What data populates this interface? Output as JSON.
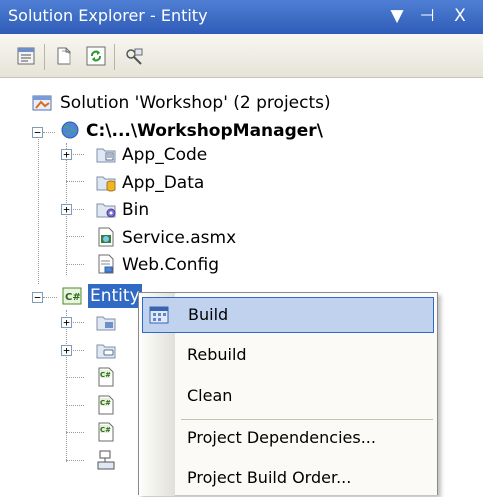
{
  "window": {
    "title": "Solution Explorer - Entity",
    "controls": {
      "dropdown": "▼",
      "pin": "⊣",
      "close": "X"
    }
  },
  "toolbar": {
    "buttons": [
      {
        "name": "properties-icon"
      },
      {
        "name": "show-all-files-icon"
      },
      {
        "name": "refresh-icon"
      },
      {
        "name": "copy-website-icon"
      }
    ]
  },
  "tree": {
    "solution": "Solution 'Workshop' (2 projects)",
    "website": "C:\\...\\WorkshopManager\\",
    "website_items": [
      "App_Code",
      "App_Data",
      "Bin",
      "Service.asmx",
      "Web.Config"
    ],
    "entity": "Entity"
  },
  "context_menu": {
    "items": [
      "Build",
      "Rebuild",
      "Clean",
      "Project Dependencies...",
      "Project Build Order..."
    ]
  },
  "colors": {
    "title_bar": "#3a67c4",
    "selection": "#316ac5",
    "menu_hover": "#c1d2ee"
  }
}
